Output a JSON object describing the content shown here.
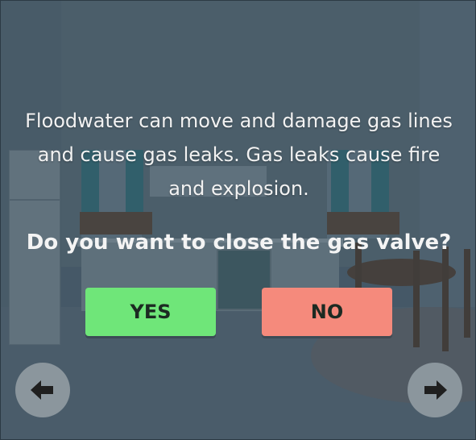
{
  "dialog": {
    "message_line1": "Floodwater can move and damage gas lines",
    "message_line2": "and cause gas leaks. Gas leaks cause fire",
    "message_line3": "and explosion.",
    "question": "Do you want to close the gas valve?",
    "yes_label": "YES",
    "no_label": "NO"
  },
  "navigation": {
    "prev_icon": "arrow-left-icon",
    "next_icon": "arrow-right-icon"
  },
  "colors": {
    "yes_button": "#6fe679",
    "no_button": "#f58a7c",
    "text": "#f2f2f2",
    "nav_button": "#8b969d"
  }
}
